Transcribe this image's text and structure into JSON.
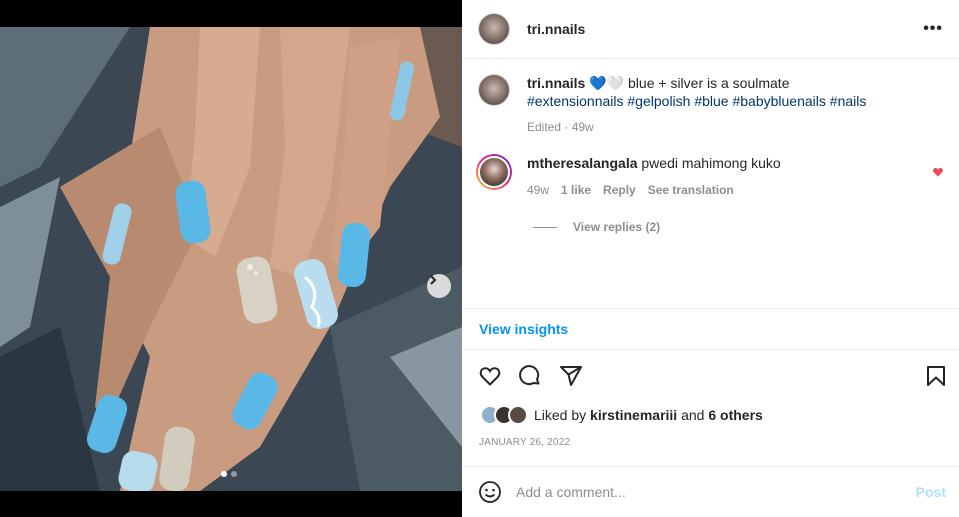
{
  "post": {
    "username": "tri.nnails",
    "caption": {
      "username": "tri.nnails",
      "emojis": "💙🤍",
      "text": "blue + silver is a soulmate",
      "hashtags": "#extensionnails #gelpolish #blue #babybluenails #nails",
      "edited": "Edited · 49w"
    },
    "comment": {
      "username": "mtheresalangala",
      "text": "pwedi mahimong kuko",
      "time": "49w",
      "likes": "1 like",
      "reply": "Reply",
      "translation": "See translation",
      "view_replies": "View replies (2)"
    },
    "view_insights": "View insights",
    "liked_by": {
      "prefix": "Liked by",
      "user": "kirstinemariii",
      "joiner": "and",
      "others": "6 others"
    },
    "date": "JANUARY 26, 2022",
    "comment_box": {
      "placeholder": "Add a comment...",
      "post": "Post"
    },
    "carousel": {
      "current": 1,
      "total": 2
    }
  },
  "colors": {
    "accent": "#0095f6",
    "hashtag": "#00376b",
    "like_heart": "#ed4956",
    "nail_blue": "#5ab8e6"
  },
  "icons": [
    "more-icon",
    "heart-icon",
    "comment-icon",
    "share-icon",
    "bookmark-icon",
    "emoji-icon",
    "chevron-right-icon"
  ]
}
